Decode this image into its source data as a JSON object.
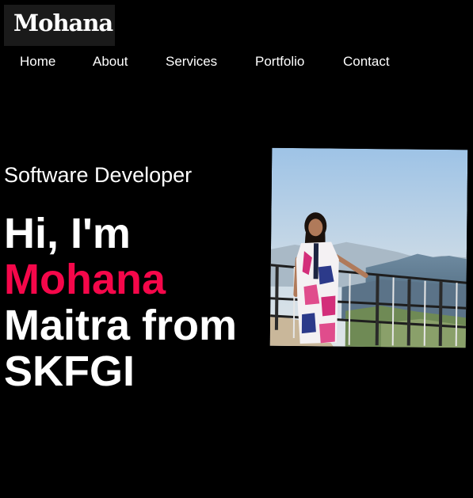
{
  "brand": {
    "logo_text": "Mohana"
  },
  "nav": {
    "items": [
      {
        "label": "Home"
      },
      {
        "label": "About"
      },
      {
        "label": "Services"
      },
      {
        "label": "Portfolio"
      },
      {
        "label": "Contact"
      }
    ]
  },
  "hero": {
    "role": "Software Developer",
    "greeting": "Hi, I'm",
    "first_name": "Mohana",
    "last_name_line": "Maitra from",
    "college": "SKFGI",
    "accent_color": "#f5074a"
  }
}
